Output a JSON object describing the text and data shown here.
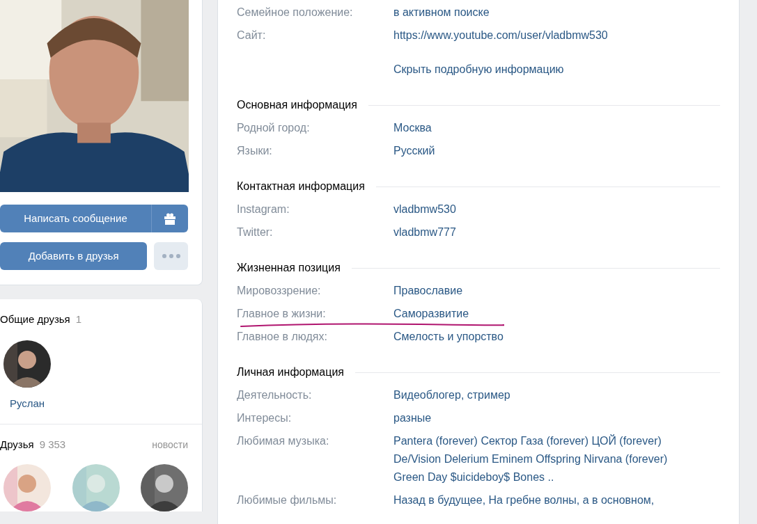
{
  "profile": {
    "actions": [
      {
        "kind": "message",
        "label": "Написать сообщение"
      },
      {
        "kind": "add",
        "label": "Добавить в друзья"
      }
    ]
  },
  "common_friends": {
    "title": "Общие друзья",
    "count": "1",
    "people": [
      {
        "name": "Руслан"
      }
    ]
  },
  "friends": {
    "title": "Друзья",
    "count": "9 353",
    "link": "новости"
  },
  "info": {
    "top_rows": [
      {
        "label": "Семейное положение:",
        "value": "в активном поиске"
      },
      {
        "label": "Сайт:",
        "value": "https://www.youtube.com/user/vladbmw530"
      }
    ],
    "toggle_link": "Скрыть подробную информацию",
    "sections": [
      {
        "title": "Основная информация",
        "rows": [
          {
            "label": "Родной город:",
            "value": "Москва"
          },
          {
            "label": "Языки:",
            "value": "Русский"
          }
        ]
      },
      {
        "title": "Контактная информация",
        "rows": [
          {
            "label": "Instagram:",
            "value": "vladbmw530"
          },
          {
            "label": "Twitter:",
            "value": "vladbmw777"
          }
        ]
      },
      {
        "title": "Жизненная позиция",
        "rows": [
          {
            "label": "Мировоззрение:",
            "value": "Православие"
          },
          {
            "label": "Главное в жизни:",
            "value": "Саморазвитие",
            "underlined": true
          },
          {
            "label": "Главное в людях:",
            "value": "Смелость и упорство"
          }
        ]
      },
      {
        "title": "Личная информация",
        "rows": [
          {
            "label": "Деятельность:",
            "value": "Видеоблогер, стример"
          },
          {
            "label": "Интересы:",
            "value": "разные"
          },
          {
            "label": "Любимая музыка:",
            "value": "Pantera (forever) Сектор Газа (forever) ЦОЙ (forever) De/Vision Delerium Eminem Offspring Nirvana (forever) Green Day $uicideboy$ Bones .."
          },
          {
            "label": "Любимые фильмы:",
            "value": "Назад в будущее, На гребне волны, а в основном,"
          }
        ]
      }
    ]
  }
}
